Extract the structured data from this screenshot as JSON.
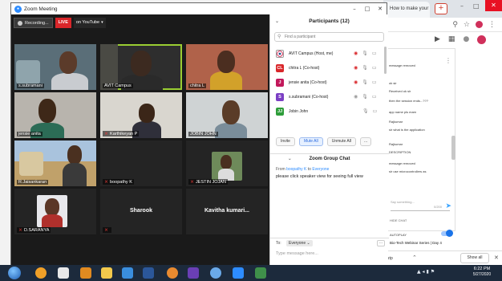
{
  "browser": {
    "tab_title": "How to make your Zoo...",
    "new_tab": "+",
    "chat_messages": [
      "message removed",
      "ok sir",
      "Received  ok sir",
      "then the session ends...???",
      "app name pls mam",
      "Rajkumar",
      "sir  what is the application",
      "Rajkumar",
      "DESCRIPTION",
      "message removed",
      "sir use microcontrollers as"
    ],
    "chat_input_placeholder": "Say something...",
    "char_count": "0/200",
    "hide_chat": "HIDE CHAT",
    "autoplay_label": "AUTOPLAY",
    "next_video": "Bio-Tech Webinar Series | Day 4",
    "download_file": ".zip",
    "show_all": "Show all"
  },
  "zoom": {
    "window_title": "Zoom Meeting",
    "recording_label": "Recording...",
    "live_label": "LIVE",
    "on_youtube_label": "on YouTube",
    "tiles": [
      {
        "name": "s.subramani",
        "muted": false,
        "active": false
      },
      {
        "name": "AVIT Campus",
        "muted": false,
        "active": true
      },
      {
        "name": "chitra L",
        "muted": false,
        "active": false
      },
      {
        "name": "jensie anita",
        "muted": false,
        "active": false
      },
      {
        "name": "Karthikeyan P",
        "muted": true,
        "active": false
      },
      {
        "name": "JOBIN JOHN",
        "muted": false,
        "active": false
      },
      {
        "name": "R.Jaisankaran",
        "muted": false,
        "active": false
      },
      {
        "name": "boopathy K",
        "muted": true,
        "active": false
      },
      {
        "name": "JESTIN JOJAN",
        "muted": true,
        "active": false
      },
      {
        "name": "D.SARANYA",
        "muted": true,
        "active": false
      },
      {
        "name": "",
        "muted": true,
        "active": false,
        "big_name": "Sharook"
      },
      {
        "name": "",
        "muted": false,
        "active": false,
        "big_name": "Kavitha  kumari..."
      }
    ]
  },
  "participants": {
    "title": "Participants (12)",
    "search_placeholder": "Find a participant",
    "list": [
      {
        "initial": "",
        "name": "AVIT Campus (Host, me)",
        "color": "#ffffff",
        "share_grey": false,
        "mic_red": false
      },
      {
        "initial": "CL",
        "name": "chitra L (Co-host)",
        "color": "#d9262a",
        "share_grey": false,
        "mic_red": false
      },
      {
        "initial": "J",
        "name": "jensie anita (Co-host)",
        "color": "#c2185b",
        "share_grey": false,
        "mic_red": false
      },
      {
        "initial": "S",
        "name": "s.subramani (Co-host)",
        "color": "#7b3fc4",
        "share_grey": true,
        "mic_red": false
      },
      {
        "initial": "JJ",
        "name": "Jobin John",
        "color": "#2e9d3a",
        "share_grey": false,
        "mic_red": false
      }
    ],
    "invite_label": "Invite",
    "mute_all_label": "Mute All",
    "unmute_all_label": "Unmute All",
    "more_label": "..."
  },
  "chat": {
    "title": "Zoom Group Chat",
    "from": "boopathy K",
    "to": "Everyone",
    "from_prefix": "From",
    "to_word": "to",
    "message": "please click speaker view for seeing full view",
    "to_label": "To:",
    "to_value": "Everyone",
    "input_placeholder": "Type message here..."
  },
  "taskbar": {
    "time": "6:22 PM",
    "date": "5/27/2020"
  },
  "colors": {
    "zoom_blue": "#2d8cff",
    "live_red": "#d9262a",
    "active_speaker": "#9acd32",
    "muted_red": "#e53935"
  }
}
